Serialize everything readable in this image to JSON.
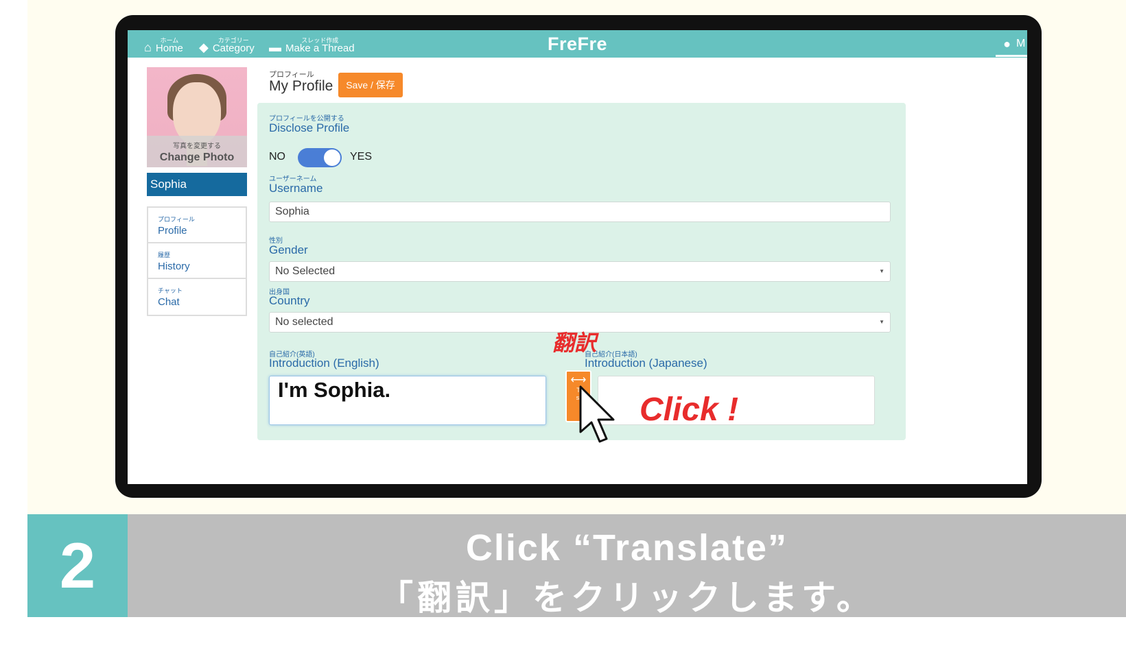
{
  "nav": {
    "home_jp": "ホーム",
    "home": "Home",
    "category_jp": "カテゴリー",
    "category": "Category",
    "thread_jp": "スレッド作成",
    "thread": "Make a Thread",
    "brand": "FreFre",
    "user_initial": "M"
  },
  "sidebar": {
    "photo_jp": "写真を変更する",
    "photo_en": "Change Photo",
    "username": "Sophia",
    "items": [
      {
        "jp": "プロフィール",
        "en": "Profile"
      },
      {
        "jp": "履歴",
        "en": "History"
      },
      {
        "jp": "チャット",
        "en": "Chat"
      }
    ]
  },
  "profile": {
    "title_jp": "プロフィール",
    "title": "My Profile",
    "save_label": "Save / 保存",
    "disclose_jp": "プロフィールを公開する",
    "disclose": "Disclose Profile",
    "toggle_no": "NO",
    "toggle_yes": "YES",
    "username_jp": "ユーザーネーム",
    "username_label": "Username",
    "username_value": "Sophia",
    "gender_jp": "性別",
    "gender_label": "Gender",
    "gender_value": "No Selected",
    "country_jp": "出身国",
    "country_label": "Country",
    "country_value": "No selected",
    "intro_en_jp": "自己紹介(英語)",
    "intro_en_label": "Introduction (English)",
    "intro_en_value": "I'm Sophia.",
    "intro_ja_jp": "自己紹介(日本語)",
    "intro_ja_label": "Introduction (Japanese)",
    "intro_ja_value": ""
  },
  "annotations": {
    "translate_jp": "翻訳",
    "click": "Click !"
  },
  "caption": {
    "step": "2",
    "en": "Click “Translate”",
    "ja": "「翻訳」をクリックします。"
  },
  "colors": {
    "navbar": "#66c2c0",
    "accent_orange": "#f6892a",
    "panel": "#dcf2e8",
    "name_bar": "#156a9e",
    "annotation_red": "#e82c2c"
  }
}
